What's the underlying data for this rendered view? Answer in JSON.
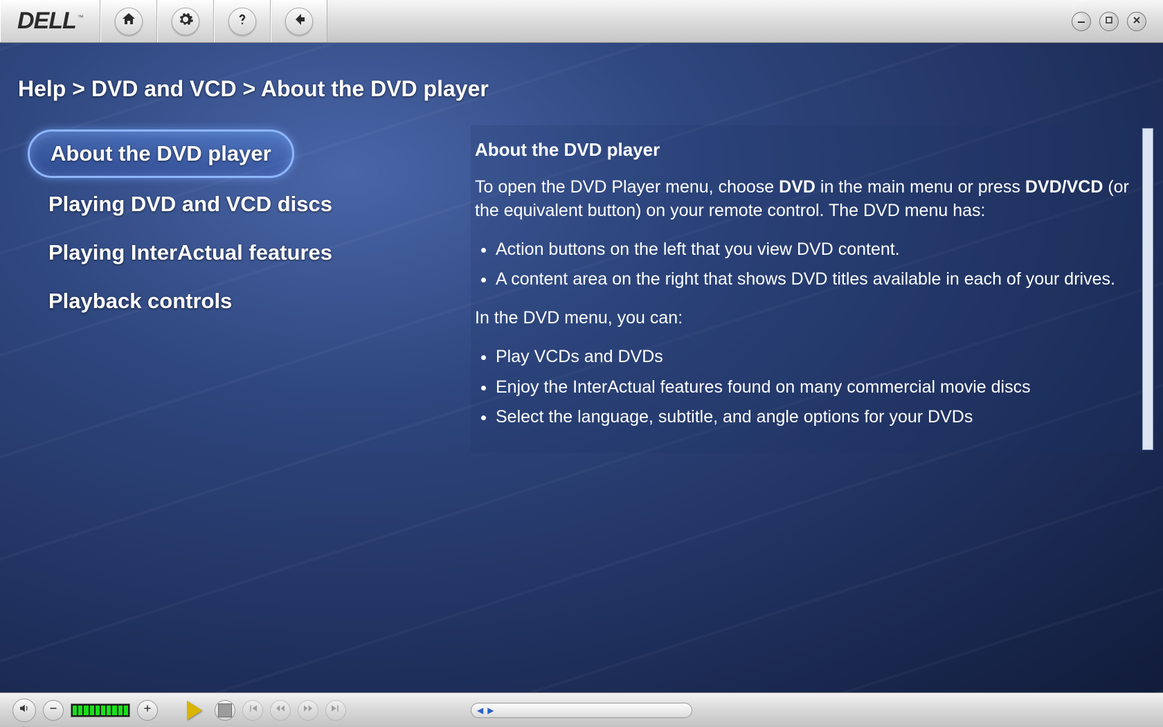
{
  "brand": {
    "name": "DELL",
    "trademark": "™"
  },
  "breadcrumb": {
    "segments": [
      "Help",
      "DVD and VCD",
      "About the DVD player"
    ],
    "separator": " > "
  },
  "nav": {
    "items": [
      {
        "label": "About the DVD player",
        "selected": true
      },
      {
        "label": "Playing DVD and VCD discs",
        "selected": false
      },
      {
        "label": "Playing InterActual features",
        "selected": false
      },
      {
        "label": "Playback controls",
        "selected": false
      }
    ]
  },
  "article": {
    "title": "About the DVD player",
    "intro_pre": "To open the DVD Player menu, choose ",
    "intro_bold1": "DVD",
    "intro_mid": " in the main menu or press ",
    "intro_bold2": "DVD/VCD",
    "intro_post": " (or the equivalent button) on your remote control. The DVD menu has:",
    "list1": [
      "Action buttons on the left that you view DVD content.",
      "A content area on the right that shows DVD titles available in each of your drives."
    ],
    "para2": "In the DVD menu, you can:",
    "list2": [
      "Play VCDs and DVDs",
      "Enjoy the InterActual features found on many commercial movie discs",
      "Select the language, subtitle, and angle options for your DVDs"
    ]
  },
  "toolbar_icons": {
    "home": "home-icon",
    "settings": "gear-icon",
    "help": "question-icon",
    "back": "back-arrow-icon"
  },
  "window_icons": {
    "minimize": "minimize-icon",
    "restore": "restore-icon",
    "close": "close-icon"
  },
  "player": {
    "volume_segments": 10,
    "volume_level": 10,
    "controls": [
      "mute",
      "vol-down",
      "volume",
      "vol-up",
      "play",
      "stop",
      "prev",
      "rewind",
      "forward",
      "next"
    ],
    "scrubber_position": 0
  },
  "colors": {
    "accent_blue": "#3f64b8",
    "selection_glow": "#8fb7ff",
    "play_yellow": "#d9b400",
    "volume_green": "#18e018"
  }
}
